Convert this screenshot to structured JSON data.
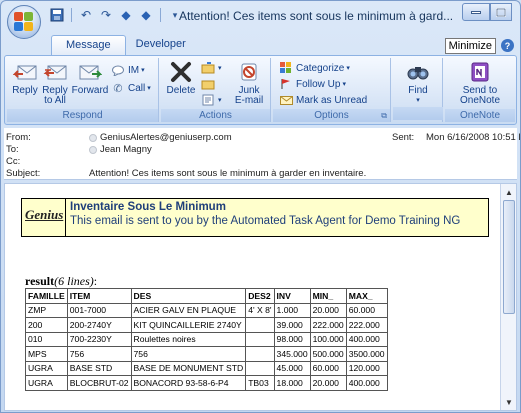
{
  "window": {
    "title": "Attention!  Ces items sont sous le minimum à gard...",
    "tooltip": "Minimize",
    "accent": "#15428b"
  },
  "tabs": [
    {
      "label": "Message",
      "active": true
    },
    {
      "label": "Developer",
      "active": false
    }
  ],
  "ribbon": {
    "respond": {
      "label": "Respond",
      "reply": "Reply",
      "reply_all_1": "Reply",
      "reply_all_2": "to All",
      "forward": "Forward",
      "im": "IM",
      "call": "Call"
    },
    "actions": {
      "label": "Actions",
      "delete": "Delete",
      "junk_1": "Junk",
      "junk_2": "E-mail"
    },
    "options": {
      "label": "Options",
      "categorize": "Categorize",
      "follow_up": "Follow Up",
      "mark_unread": "Mark as Unread"
    },
    "find": {
      "label": "Find"
    },
    "onenote": {
      "label": "OneNote",
      "send_1": "Send to",
      "send_2": "OneNote"
    }
  },
  "header": {
    "from_label": "From:",
    "from": "GeniusAlertes@geniuserp.com",
    "to_label": "To:",
    "to": "Jean Magny",
    "cc_label": "Cc:",
    "subject_label": "Subject:",
    "subject": "Attention!  Ces items sont sous le minimum à garder en inventaire.",
    "sent_label": "Sent:",
    "sent": "Mon 6/16/2008 10:51 PM"
  },
  "body": {
    "logo": "Genius",
    "banner_title": "Inventaire Sous Le Minimum",
    "banner_sub": "This email is sent to you by the Automated Task Agent for Demo Training NG",
    "result_label": "result",
    "result_count": "(6 lines)",
    "result_colon": ":",
    "columns": [
      "FAMILLE",
      "ITEM",
      "DES",
      "DES2",
      "INV",
      "MIN_",
      "MAX_"
    ],
    "rows": [
      [
        "ZMP",
        "001-7000",
        "ACIER GALV EN PLAQUE",
        "4' X 8'",
        "1.000",
        "20.000",
        "60.000"
      ],
      [
        "200",
        "200-2740Y",
        "KIT QUINCAILLERIE 2740Y",
        "",
        "39.000",
        "222.000",
        "222.000"
      ],
      [
        "010",
        "700-2230Y",
        "Roulettes noires",
        "",
        "98.000",
        "100.000",
        "400.000"
      ],
      [
        "MPS",
        "756",
        "756",
        "",
        "345.000",
        "500.000",
        "3500.000"
      ],
      [
        "UGRA",
        "BASE STD",
        "BASE DE MONUMENT STD",
        "",
        "45.000",
        "60.000",
        "120.000"
      ],
      [
        "UGRA",
        "BLOCBRUT-02",
        "BONACORD 93-58-6-P4",
        "TB03",
        "18.000",
        "20.000",
        "400.000"
      ]
    ]
  }
}
